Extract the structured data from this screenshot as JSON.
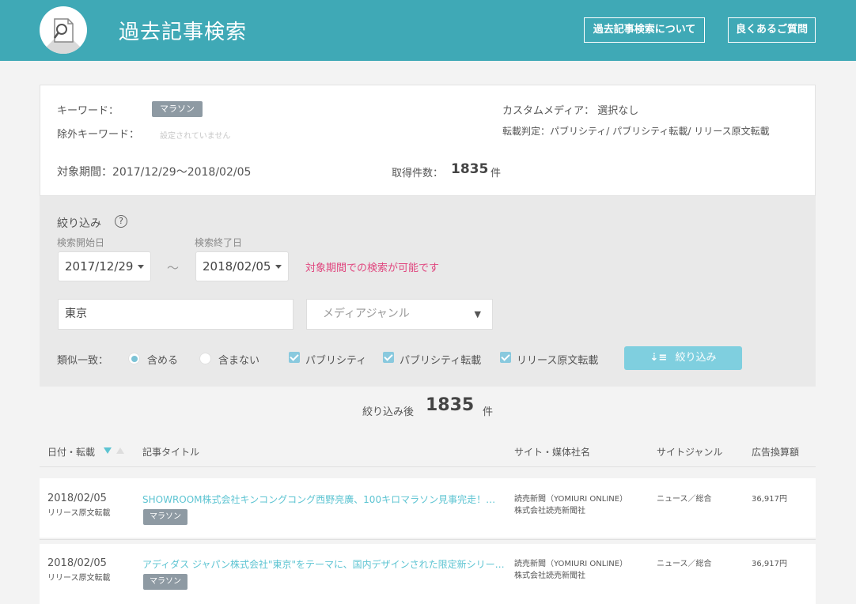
{
  "header": {
    "title": "過去記事検索",
    "about_button": "過去記事検索について",
    "faq_button": "良くあるご質問"
  },
  "summary": {
    "keyword_label": "キーワード：",
    "keyword_tag": "マラソン",
    "exclude_label": "除外キーワード：",
    "exclude_value": "設定されていません",
    "custom_media": "カスタムメディア： 選択なし",
    "classification": "転載判定：パブリシティ/ パブリシティ転載/ リリース原文転載",
    "period": "対象期間：2017/12/29〜2018/02/05",
    "count_label": "取得件数：",
    "count_value": "1835",
    "count_unit": "件"
  },
  "filter": {
    "title": "絞り込み",
    "help_icon": "?",
    "start_label": "検索開始日",
    "end_label": "検索終了日",
    "start_value": "2017/12/29",
    "end_value": "2018/02/05",
    "tilde": "〜",
    "notice": "対象期間での検索が可能です",
    "keyword_value": "東京",
    "genre_placeholder": "メディアジャンル",
    "similar_label": "類似一致：",
    "include_label": "含める",
    "exclude_label": "含まない",
    "cb1": "パブリシティ",
    "cb2": "パブリシティ転載",
    "cb3": "リリース原文転載",
    "apply_label": "絞り込み"
  },
  "result": {
    "label": "絞り込み後",
    "count": "1835",
    "unit": "件"
  },
  "table": {
    "headers": [
      "日付・転載",
      "記事タイトル",
      "サイト・媒体社名",
      "サイトジャンル",
      "広告換算額"
    ],
    "rows": [
      {
        "date": "2018/02/05",
        "type": "リリース原文転載",
        "title": "SHOWROOM株式会社キンコングコング西野亮廣、100キロマラソン見事完走！…",
        "tag": "マラソン",
        "site": "読売新聞（YOMIURI ONLINE）",
        "company": "株式会社読売新聞社",
        "genre": "ニュース／総合",
        "amount": "36,917円"
      },
      {
        "date": "2018/02/05",
        "type": "リリース原文転載",
        "title": "アディダス ジャパン株式会社\"東京\"をテーマに、国内デザインされた限定新シリー…",
        "tag": "マラソン",
        "site": "読売新聞（YOMIURI ONLINE）",
        "company": "株式会社読売新聞社",
        "genre": "ニュース／総合",
        "amount": "36,917円"
      }
    ]
  },
  "colors": {
    "header": "#3fa9b6",
    "link": "#5dc4d2",
    "notice": "#e0467e",
    "button": "#7fcfdf"
  }
}
